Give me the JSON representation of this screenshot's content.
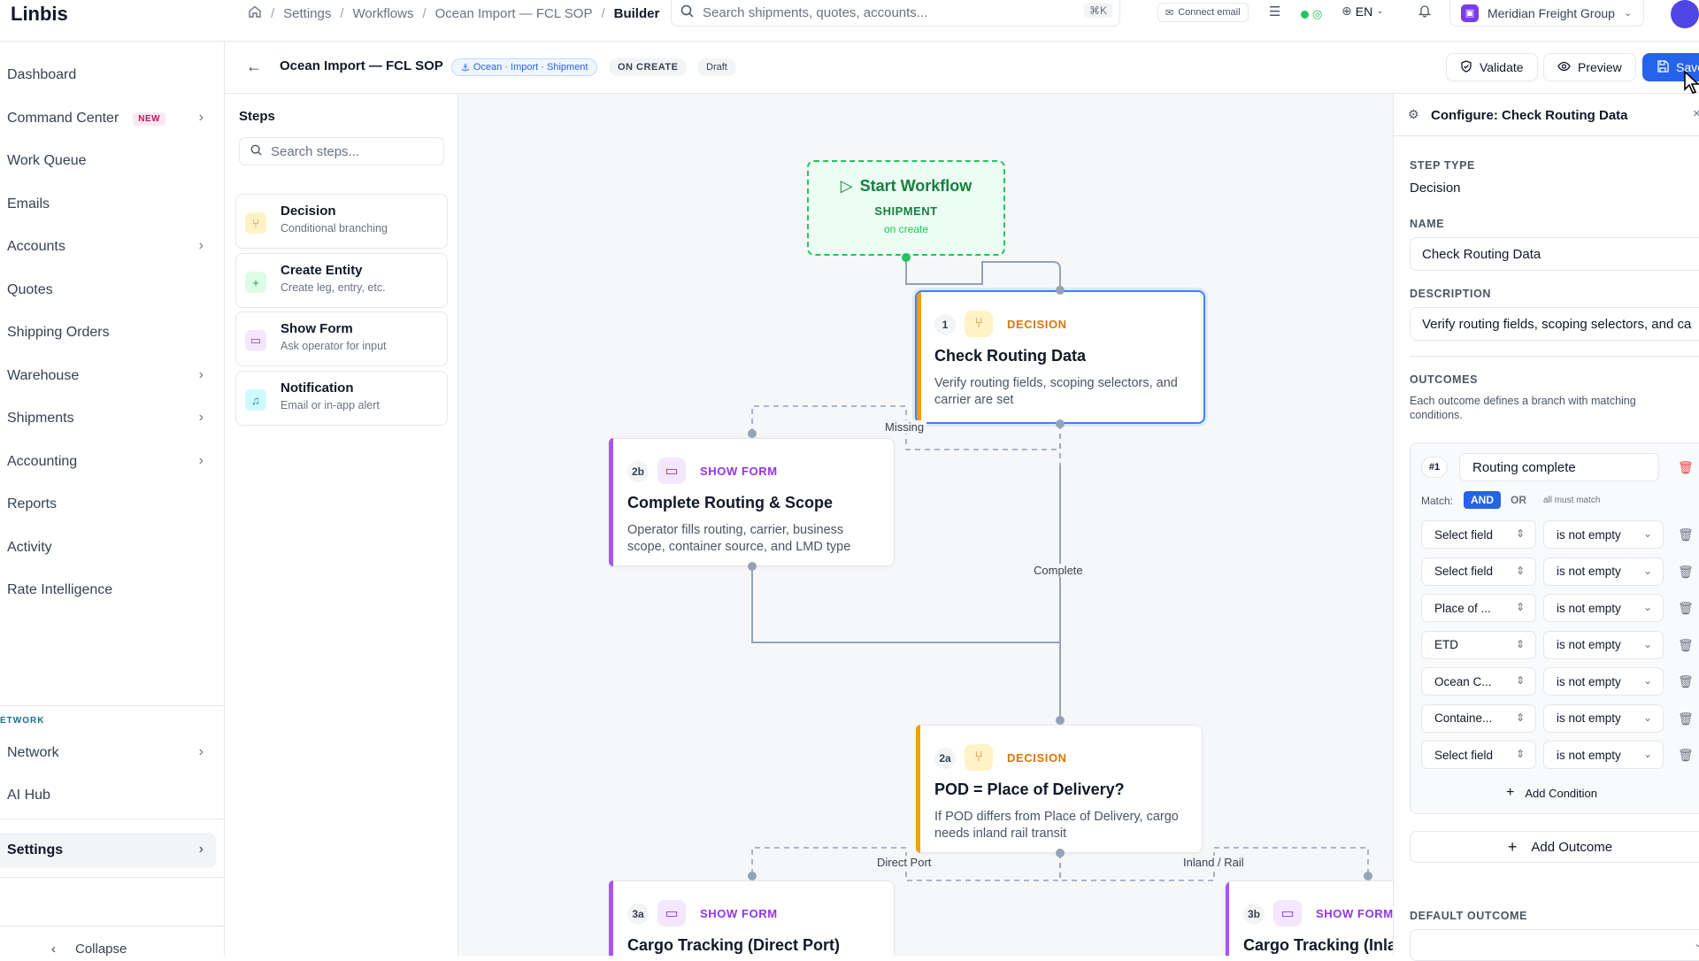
{
  "app": {
    "name": "Linbis"
  },
  "breadcrumbs": [
    "Settings",
    "Workflows",
    "Ocean Import — FCL SOP",
    "Builder"
  ],
  "search": {
    "placeholder": "Search shipments, quotes, accounts...",
    "shortcut": "⌘K"
  },
  "topbar": {
    "connect_email": "Connect email",
    "language": "EN",
    "org_name": "Meridian Freight Group"
  },
  "sidebar": {
    "items": [
      {
        "label": "Dashboard"
      },
      {
        "label": "Command Center",
        "badge": "NEW"
      },
      {
        "label": "Work Queue"
      },
      {
        "label": "Emails"
      },
      {
        "label": "Accounts"
      },
      {
        "label": "Quotes"
      },
      {
        "label": "Shipping Orders"
      },
      {
        "label": "Warehouse"
      },
      {
        "label": "Shipments"
      },
      {
        "label": "Accounting"
      },
      {
        "label": "Reports"
      },
      {
        "label": "Activity"
      },
      {
        "label": "Rate Intelligence"
      }
    ],
    "section_label": "ETWORK",
    "network_items": [
      {
        "label": "Network"
      },
      {
        "label": "AI Hub"
      }
    ],
    "settings": "Settings",
    "collapse": "Collapse"
  },
  "workflow": {
    "title": "Ocean Import — FCL SOP",
    "scope_tag": "Ocean · Import · Shipment",
    "trigger_tag": "ON CREATE",
    "status_tag": "Draft",
    "validate": "Validate",
    "preview": "Preview",
    "save": "Save"
  },
  "steps_panel": {
    "title": "Steps",
    "search_placeholder": "Search steps...",
    "items": [
      {
        "title": "Decision",
        "subtitle": "Conditional branching",
        "icon": "branch-icon",
        "color": "#f59e0b"
      },
      {
        "title": "Create Entity",
        "subtitle": "Create leg, entry, etc.",
        "icon": "plus-icon",
        "color": "#22c55e"
      },
      {
        "title": "Show Form",
        "subtitle": "Ask operator for input",
        "icon": "form-icon",
        "color": "#a855f7"
      },
      {
        "title": "Notification",
        "subtitle": "Email or in-app alert",
        "icon": "bell-icon",
        "color": "#06b6d4"
      }
    ]
  },
  "canvas": {
    "start": {
      "title": "Start Workflow",
      "entity": "SHIPMENT",
      "trigger": "on create"
    },
    "nodes": [
      {
        "num": "1",
        "kind": "DECISION",
        "title": "Check Routing Data",
        "desc": "Verify routing fields, scoping selectors, and carrier are set"
      },
      {
        "num": "2b",
        "kind": "SHOW FORM",
        "title": "Complete Routing & Scope",
        "desc": "Operator fills routing, carrier, business scope, container source, and LMD type"
      },
      {
        "num": "2a",
        "kind": "DECISION",
        "title": "POD = Place of Delivery?",
        "desc": "If POD differs from Place of Delivery, cargo needs inland rail transit"
      },
      {
        "num": "3a",
        "kind": "SHOW FORM",
        "title": "Cargo Tracking (Direct Port)",
        "desc": ""
      },
      {
        "num": "3b",
        "kind": "SHOW FORM",
        "title": "Cargo Tracking (Inla",
        "desc": ""
      }
    ],
    "edge_labels": {
      "missing": "Missing",
      "complete": "Complete",
      "direct_port": "Direct Port",
      "inland_rail": "Inland / Rail"
    }
  },
  "config": {
    "title": "Configure: Check Routing Data",
    "step_type_label": "STEP TYPE",
    "step_type": "Decision",
    "name_label": "NAME",
    "name_value": "Check Routing Data",
    "description_label": "DESCRIPTION",
    "description_value": "Verify routing fields, scoping selectors, and ca",
    "outcomes_label": "OUTCOMES",
    "outcomes_help": "Each outcome defines a branch with matching conditions.",
    "outcome": {
      "index": "#1",
      "name": "Routing complete",
      "match_label": "Match:",
      "and": "AND",
      "or": "OR",
      "match_hint": "all must match",
      "conditions": [
        {
          "field": "Select field",
          "op": "is not empty"
        },
        {
          "field": "Select field",
          "op": "is not empty"
        },
        {
          "field": "Place of ...",
          "op": "is not empty"
        },
        {
          "field": "ETD",
          "op": "is not empty"
        },
        {
          "field": "Ocean C...",
          "op": "is not empty"
        },
        {
          "field": "Containe...",
          "op": "is not empty"
        },
        {
          "field": "Select field",
          "op": "is not empty"
        }
      ],
      "add_condition": "Add Condition"
    },
    "add_outcome": "Add Outcome",
    "default_outcome_label": "DEFAULT OUTCOME"
  }
}
